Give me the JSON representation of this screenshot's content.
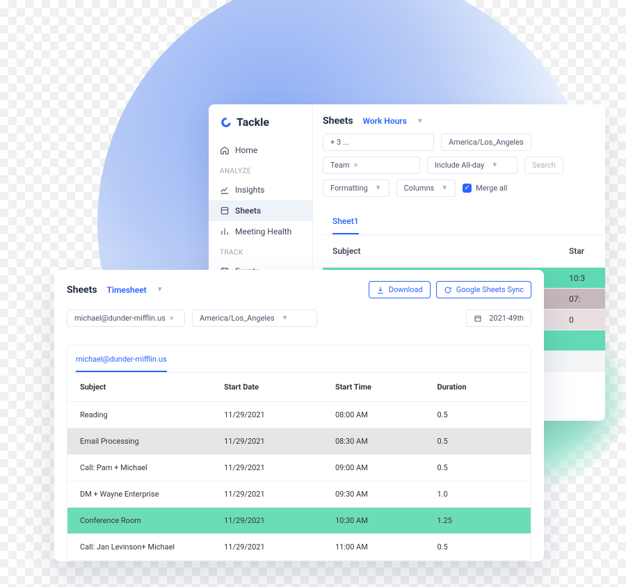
{
  "brand": "Tackle",
  "sidebar": {
    "groups": {
      "g0": {
        "items": [
          {
            "label": "Home"
          }
        ]
      },
      "g1": {
        "label": "ANALYZE",
        "items": [
          {
            "label": "Insights"
          },
          {
            "label": "Sheets"
          },
          {
            "label": "Meeting Health"
          }
        ]
      },
      "g2": {
        "label": "TRACK",
        "items": [
          {
            "label": "Events"
          }
        ]
      }
    }
  },
  "main": {
    "title": "Sheets",
    "subtitle": "Work Hours",
    "plus3": "+ 3 ...",
    "timezone": "America/Los_Angeles",
    "team_chip": "Team",
    "allday": "Include All-day",
    "search_placeholder": "Search",
    "formatting": "Formatting",
    "columns": "Columns",
    "merge": "Merge all",
    "sheet_tab": "Sheet1",
    "headers": {
      "subject": "Subject",
      "start": "Star"
    },
    "rows": [
      {
        "start": "10:3"
      },
      {
        "start": "07:"
      },
      {
        "start": "0"
      },
      {
        "start": ""
      },
      {
        "start": ""
      }
    ]
  },
  "ts": {
    "title": "Sheets",
    "subtitle": "Timesheet",
    "download": "Download",
    "sync": "Google Sheets Sync",
    "email_chip": "michael@dunder-mifflin.us",
    "timezone": "America/Los_Angeles",
    "date": "2021-49th",
    "tab": "michael@dunder-mifflin.us",
    "headers": {
      "subject": "Subject",
      "startdate": "Start Date",
      "starttime": "Start Time",
      "duration": "Duration"
    },
    "rows": [
      {
        "subject": "Reading",
        "date": "11/29/2021",
        "time": "08:00 AM",
        "dur": "0.5"
      },
      {
        "subject": "Email Processing",
        "date": "11/29/2021",
        "time": "08:30 AM",
        "dur": "0.5"
      },
      {
        "subject": "Call: Pam + Michael",
        "date": "11/29/2021",
        "time": "09:00 AM",
        "dur": "0.5"
      },
      {
        "subject": "DM + Wayne Enterprise",
        "date": "11/29/2021",
        "time": "09:30 AM",
        "dur": "1.0"
      },
      {
        "subject": "Conference Room",
        "date": "11/29/2021",
        "time": "10:30 AM",
        "dur": "1.25"
      },
      {
        "subject": "Call: Jan Levinson+ Michael",
        "date": "11/29/2021",
        "time": "11:00 AM",
        "dur": "0.5"
      }
    ]
  }
}
